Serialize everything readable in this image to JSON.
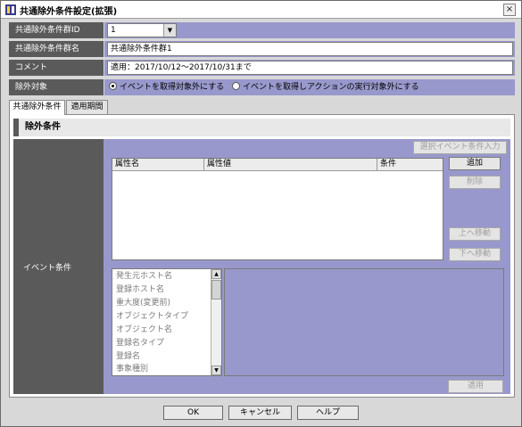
{
  "window": {
    "title": "共通除外条件設定(拡張)",
    "close_label": "×"
  },
  "form": {
    "group_id": {
      "label": "共通除外条件群ID",
      "value": "1"
    },
    "group_name": {
      "label": "共通除外条件群名",
      "value": "共通除外条件群1"
    },
    "comment": {
      "label": "コメント",
      "value": "適用：2017/10/12～2017/10/31まで"
    },
    "exclusion_target": {
      "label": "除外対象",
      "options": [
        {
          "label": "イベントを取得対象外にする",
          "selected": true
        },
        {
          "label": "イベントを取得しアクションの実行対象外にする",
          "selected": false
        }
      ]
    }
  },
  "tabs": [
    {
      "label": "共通除外条件",
      "active": true
    },
    {
      "label": "適用期間",
      "active": false
    }
  ],
  "panel": {
    "section_title": "除外条件",
    "event_condition_label": "イベント条件",
    "select_event_button": "選択イベント条件入力",
    "table_columns": [
      "属性名",
      "属性値",
      "条件"
    ],
    "buttons": {
      "add": "追加",
      "delete": "削除",
      "move_up": "上へ移動",
      "move_down": "下へ移動",
      "apply": "適用"
    },
    "attributes": [
      "発生元ホスト名",
      "登録ホスト名",
      "重大度(変更前)",
      "オブジェクトタイプ",
      "オブジェクト名",
      "登録名タイプ",
      "登録名",
      "事象種別"
    ]
  },
  "footer": {
    "ok": "OK",
    "cancel": "キャンセル",
    "help": "ヘルプ"
  },
  "colors": {
    "label_bg": "#5a5a5a",
    "field_bg": "#9898cc"
  }
}
